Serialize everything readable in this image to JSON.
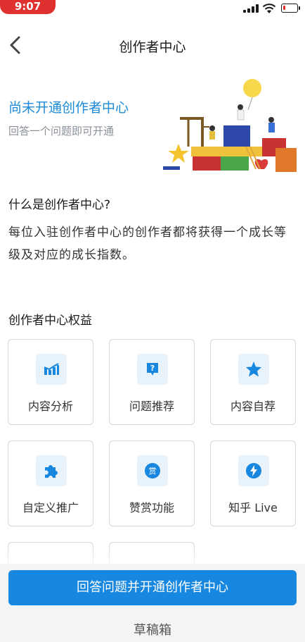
{
  "status": {
    "time": "9:07"
  },
  "nav": {
    "title": "创作者中心"
  },
  "hero": {
    "title": "尚未开通创作者中心",
    "subtitle": "回答一个问题即可开通"
  },
  "about": {
    "heading": "什么是创作者中心?",
    "description": "每位入驻创作者中心的创作者都将获得一个成长等级及对应的成长指数。"
  },
  "benefits": {
    "heading": "创作者中心权益",
    "items": [
      {
        "label": "内容分析",
        "icon": "bar-chart-icon"
      },
      {
        "label": "问题推荐",
        "icon": "question-icon"
      },
      {
        "label": "内容自荐",
        "icon": "star-icon"
      },
      {
        "label": "自定义推广",
        "icon": "puzzle-icon"
      },
      {
        "label": "赞赏功能",
        "icon": "reward-icon"
      },
      {
        "label": "知乎 Live",
        "icon": "lightning-icon"
      }
    ]
  },
  "cta": {
    "label": "回答问题并开通创作者中心"
  },
  "drafts": {
    "label": "草稿箱"
  },
  "colors": {
    "accent": "#1787e0",
    "hero_title": "#1c8ad6",
    "icon_bg": "#e8f2fb",
    "status_pill": "#e03131"
  }
}
